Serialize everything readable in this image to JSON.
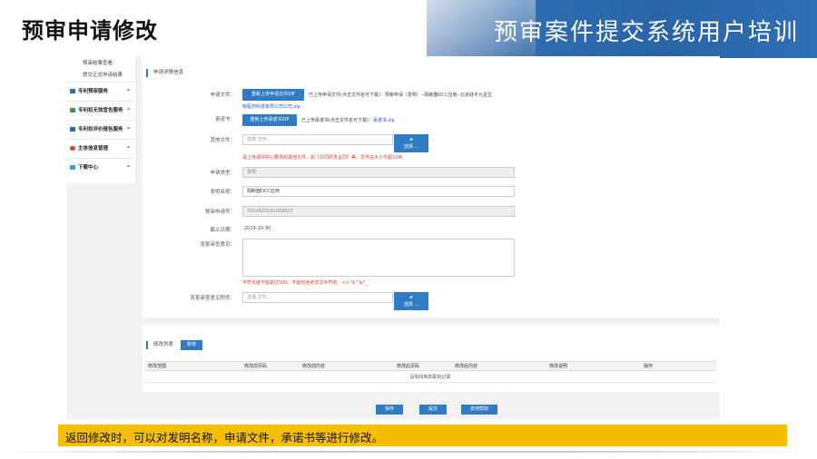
{
  "slide": {
    "title": "预审申请修改",
    "banner_title": "预审案件提交系统用户培训",
    "caption": "返回修改时，可以对发明名称，申请文件，承诺书等进行修改。"
  },
  "sidebar": {
    "sub_items": [
      "预审结果查看",
      "提交正式申请结果"
    ],
    "items": [
      {
        "label": "专利预审服务",
        "icon": "folder-icon",
        "arrow": "^"
      },
      {
        "label": "专利权无效宣告服务",
        "icon": "doc-icon",
        "arrow": "^"
      },
      {
        "label": "专利权评价报告服务",
        "icon": "folder-icon",
        "arrow": "^"
      },
      {
        "label": "主体信息管理",
        "icon": "people-icon",
        "arrow": "^"
      },
      {
        "label": "下载中心",
        "icon": "download-icon",
        "arrow": "^"
      }
    ]
  },
  "form": {
    "section_title": "申请详情信息",
    "application_file": {
      "label": "申请文件：",
      "button": "重新上传申请文件ZIP",
      "status": "已上传申请文件(点击文件名可下载)：预审申请（发明）--隔断器DCC应用--北京硅平九星生",
      "status2": "物医药科技有限公司公司.zip"
    },
    "commitment": {
      "label": "承诺书：",
      "button": "重新上传承诺书ZIP",
      "status": "已上传承诺书(点击文件名可下载)：",
      "file": "承诺书.zip"
    },
    "other_files": {
      "label": "其他文件：",
      "placeholder": "选择 文件...",
      "choose": "选择 ...",
      "warning": "请上传调评中心要求的其他文件，如《共同研发合同》等，文件总大小不超10M。"
    },
    "app_type": {
      "label": "申请类型：",
      "value": "发明"
    },
    "invention_name": {
      "label": "发明名称：",
      "value": "隔断器DCC应用"
    },
    "preexam_no": {
      "label": "预审申请号：",
      "value": "Y501820191000023"
    },
    "deadline": {
      "label": "截止日期：",
      "value": "2019-10-30"
    },
    "reply_opinion": {
      "label": "答复审查意见：",
      "warning": "字符长度不能超过500；不能包含的非法字符有：<>'!$^&*_"
    },
    "reply_attachment": {
      "label": "答复审查意见附件：",
      "placeholder": "选择 文件...",
      "choose": "选择 ..."
    }
  },
  "list": {
    "title": "修改列表",
    "add_button": "新增",
    "columns": [
      "修改范围",
      "修改前页码",
      "修改前内容",
      "修改后页码",
      "修改后内容",
      "修改说明",
      "操作"
    ],
    "empty": "没有找到匹配的记录"
  },
  "actions": {
    "save": "保存",
    "submit": "提交",
    "back": "去他帮助"
  },
  "colors": {
    "accent_blue": "#2f7bc4",
    "caption_yellow": "#f5be00",
    "warning_red": "#d23c2c"
  }
}
